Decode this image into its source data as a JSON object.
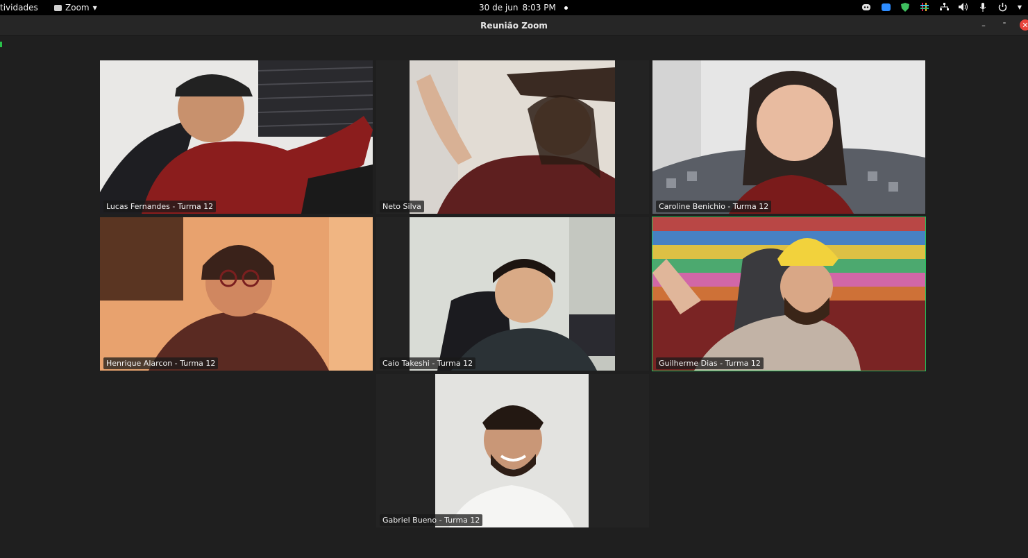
{
  "topbar": {
    "activities": "tividades",
    "app_menu": "Zoom",
    "date": "30 de jun",
    "time": "8:03 PM",
    "tray_icons": [
      "discord-icon",
      "zoom-tray-icon",
      "shield-icon",
      "slack-icon",
      "network-icon",
      "volume-icon",
      "microphone-icon",
      "power-icon"
    ]
  },
  "window": {
    "title": "Reunião Zoom"
  },
  "participants": [
    {
      "name": "Lucas Fernandes - Turma 12"
    },
    {
      "name": "Neto Silva"
    },
    {
      "name": "Caroline Benichio - Turma 12"
    },
    {
      "name": "Henrique Alarcon - Turma 12"
    },
    {
      "name": "Caio Takeshi - Turma 12"
    },
    {
      "name": "Guilherme Dias - Turma 12",
      "active_speaker": true
    },
    {
      "name": "Gabriel Bueno - Turma 12"
    }
  ],
  "colors": {
    "active_speaker_border": "#1fc45a",
    "background": "#1f1f1f",
    "close_button": "#e8453c"
  }
}
